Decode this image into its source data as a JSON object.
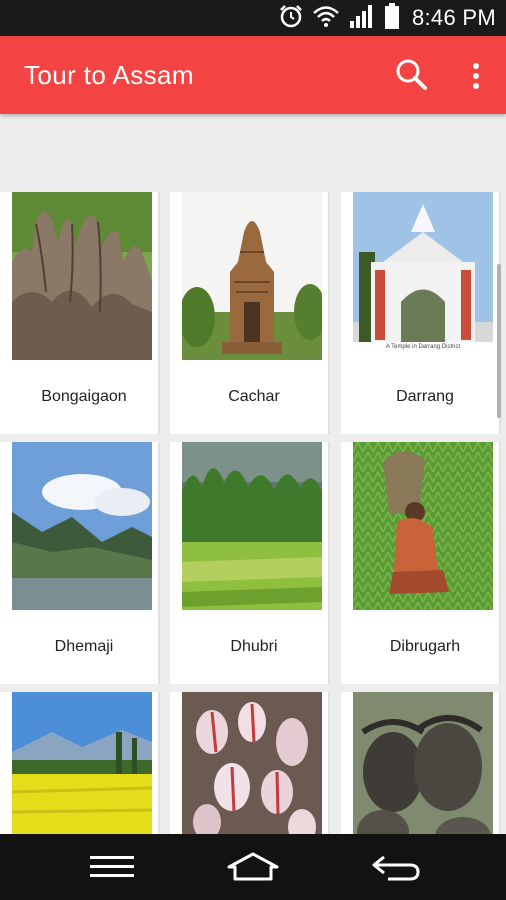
{
  "status_bar": {
    "time": "8:46 PM",
    "icons": [
      "alarm-icon",
      "wifi-icon",
      "signal-icon",
      "battery-icon"
    ]
  },
  "app_bar": {
    "title": "Tour to Assam",
    "background": "#f44343",
    "actions": [
      "search-icon",
      "more-vert-icon"
    ]
  },
  "districts": [
    {
      "name": "Bongaigaon",
      "image": "rock-formation-photo"
    },
    {
      "name": "Cachar",
      "image": "stone-temple-photo"
    },
    {
      "name": "Darrang",
      "image": "white-temple-gate-photo",
      "caption": "A Temple in Darrang District"
    },
    {
      "name": "Dhemaji",
      "image": "river-mountains-photo"
    },
    {
      "name": "Dhubri",
      "image": "green-fields-photo"
    },
    {
      "name": "Dibrugarh",
      "image": "tea-picker-photo"
    },
    {
      "name": "",
      "image": "mustard-field-photo"
    },
    {
      "name": "",
      "image": "flamingos-photo"
    },
    {
      "name": "",
      "image": "water-buffalo-photo"
    }
  ],
  "nav_bar": {
    "buttons": [
      "menu-icon",
      "home-icon",
      "back-icon"
    ]
  }
}
